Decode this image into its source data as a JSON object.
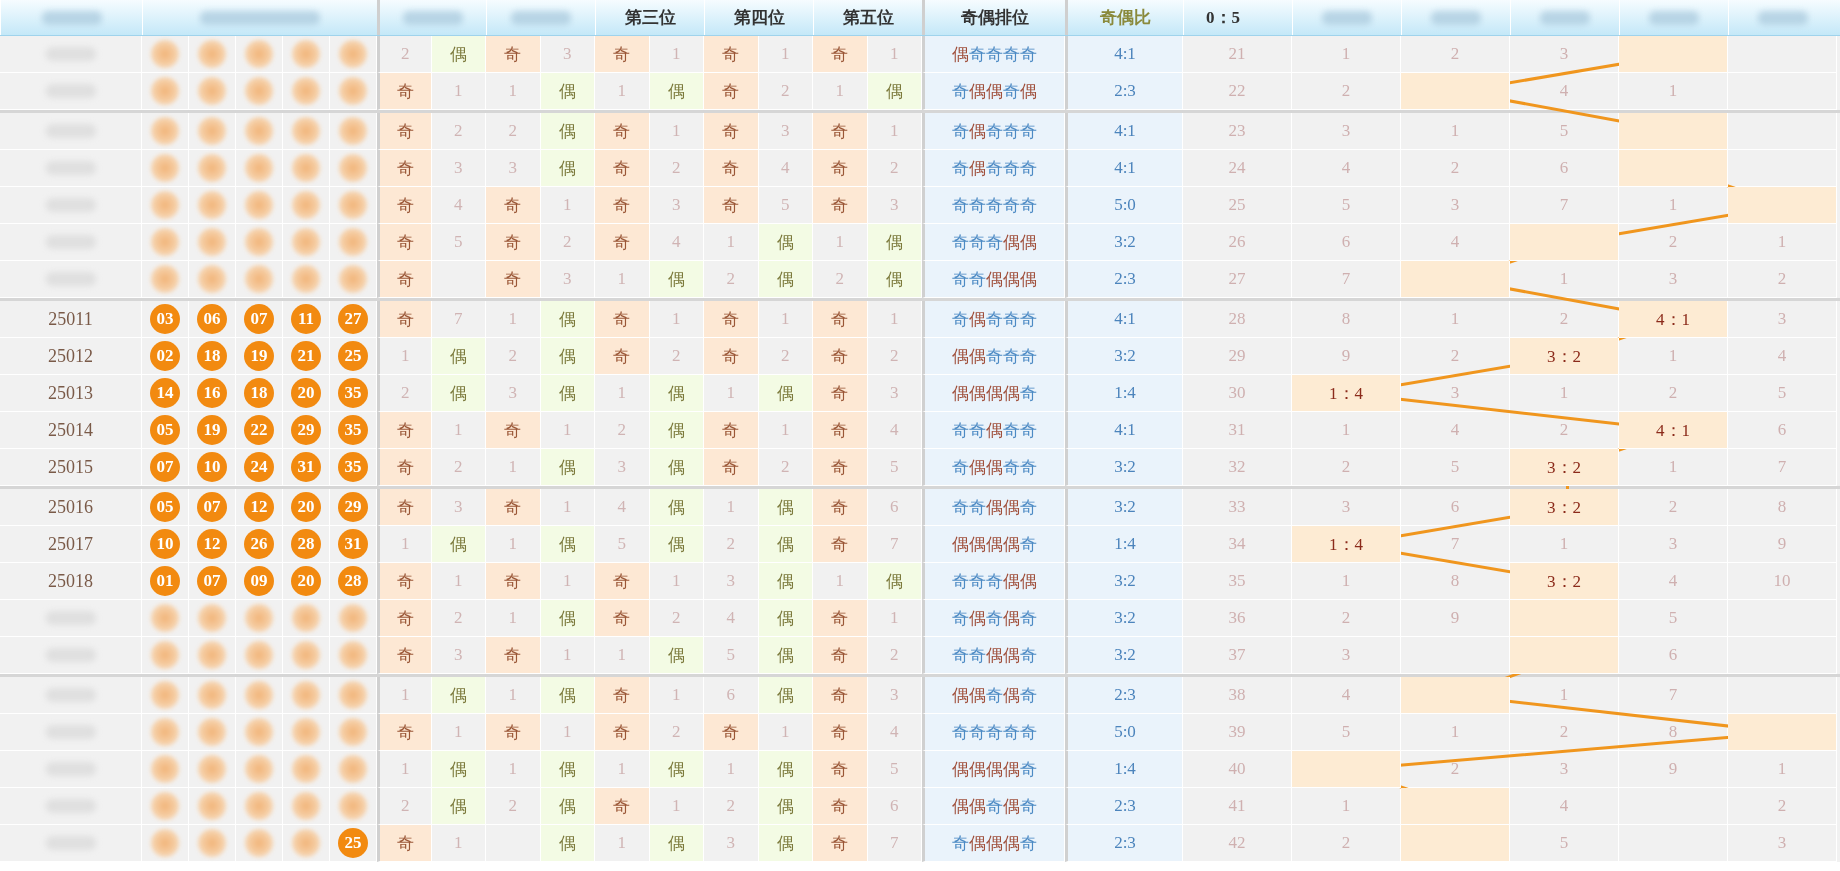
{
  "headers": {
    "issue": {
      "obscured": true
    },
    "balls": {
      "obscured": true
    },
    "positions": [
      {
        "obscured": true
      },
      {
        "obscured": true
      },
      {
        "obscured": false,
        "text": "第三位"
      },
      {
        "obscured": false,
        "text": "第四位"
      },
      {
        "obscured": false,
        "text": "第五位"
      }
    ],
    "pattern": "奇偶排位",
    "ratio": "奇偶比",
    "distribution": [
      {
        "obscured": false,
        "text": "0：5"
      },
      {
        "obscured": true
      },
      {
        "obscured": true
      },
      {
        "obscured": true
      },
      {
        "obscured": true
      },
      {
        "obscured": true
      }
    ]
  },
  "groups": [
    {
      "rows": [
        {
          "issue": {
            "obscured": true
          },
          "balls": [
            {
              "obscured": true
            },
            {
              "obscured": true
            },
            {
              "obscured": true
            },
            {
              "obscured": true
            },
            {
              "obscured": true
            }
          ],
          "positions": [
            {
              "kind": "even",
              "mark": "偶",
              "miss": "2"
            },
            {
              "kind": "odd",
              "mark": "奇",
              "miss": "3"
            },
            {
              "kind": "odd",
              "mark": "奇",
              "miss": "1"
            },
            {
              "kind": "odd",
              "mark": "奇",
              "miss": "1"
            },
            {
              "kind": "odd",
              "mark": "奇",
              "miss": "1"
            }
          ],
          "pattern": "偶奇奇奇奇",
          "ratio": "4:1",
          "distribution": [
            {
              "text": "21",
              "hit": false
            },
            {
              "text": "1",
              "hit": false
            },
            {
              "text": "2",
              "hit": false
            },
            {
              "text": "3",
              "hit": false
            },
            {
              "hit": true
            },
            {
              "hit": false
            }
          ]
        },
        {
          "issue": {
            "obscured": true
          },
          "balls": [
            {
              "obscured": true
            },
            {
              "obscured": true
            },
            {
              "obscured": true
            },
            {
              "obscured": true
            },
            {
              "obscured": true
            }
          ],
          "positions": [
            {
              "kind": "odd",
              "mark": "奇",
              "miss": "1"
            },
            {
              "kind": "even",
              "mark": "偶",
              "miss": "1"
            },
            {
              "kind": "even",
              "mark": "偶",
              "miss": "1"
            },
            {
              "kind": "odd",
              "mark": "奇",
              "miss": "2"
            },
            {
              "kind": "even",
              "mark": "偶",
              "miss": "1"
            }
          ],
          "pattern": "奇偶偶奇偶",
          "ratio": "2:3",
          "distribution": [
            {
              "text": "22",
              "hit": false
            },
            {
              "text": "2",
              "hit": false
            },
            {
              "hit": true
            },
            {
              "text": "4",
              "hit": false
            },
            {
              "text": "1",
              "hit": false
            },
            {
              "hit": false
            }
          ]
        }
      ]
    },
    {
      "rows": [
        {
          "issue": {
            "obscured": true
          },
          "balls": [
            {
              "obscured": true
            },
            {
              "obscured": true
            },
            {
              "obscured": true
            },
            {
              "obscured": true
            },
            {
              "obscured": true
            }
          ],
          "positions": [
            {
              "kind": "odd",
              "mark": "奇",
              "miss": "2"
            },
            {
              "kind": "even",
              "mark": "偶",
              "miss": "2"
            },
            {
              "kind": "odd",
              "mark": "奇",
              "miss": "1"
            },
            {
              "kind": "odd",
              "mark": "奇",
              "miss": "3"
            },
            {
              "kind": "odd",
              "mark": "奇",
              "miss": "1"
            }
          ],
          "pattern": "奇偶奇奇奇",
          "ratio": "4:1",
          "distribution": [
            {
              "text": "23",
              "hit": false
            },
            {
              "text": "3",
              "hit": false
            },
            {
              "text": "1",
              "hit": false
            },
            {
              "text": "5",
              "hit": false
            },
            {
              "hit": true
            },
            {
              "hit": false
            }
          ]
        },
        {
          "issue": {
            "obscured": true
          },
          "balls": [
            {
              "obscured": true
            },
            {
              "obscured": true
            },
            {
              "obscured": true
            },
            {
              "obscured": true
            },
            {
              "obscured": true
            }
          ],
          "positions": [
            {
              "kind": "odd",
              "mark": "奇",
              "miss": "3"
            },
            {
              "kind": "even",
              "mark": "偶",
              "miss": "3"
            },
            {
              "kind": "odd",
              "mark": "奇",
              "miss": "2"
            },
            {
              "kind": "odd",
              "mark": "奇",
              "miss": "4"
            },
            {
              "kind": "odd",
              "mark": "奇",
              "miss": "2"
            }
          ],
          "pattern": "奇偶奇奇奇",
          "ratio": "4:1",
          "distribution": [
            {
              "text": "24",
              "hit": false
            },
            {
              "text": "4",
              "hit": false
            },
            {
              "text": "2",
              "hit": false
            },
            {
              "text": "6",
              "hit": false
            },
            {
              "hit": true
            },
            {
              "hit": false
            }
          ]
        },
        {
          "issue": {
            "obscured": true
          },
          "balls": [
            {
              "obscured": true
            },
            {
              "obscured": true
            },
            {
              "obscured": true
            },
            {
              "obscured": true
            },
            {
              "obscured": true
            }
          ],
          "positions": [
            {
              "kind": "odd",
              "mark": "奇",
              "miss": "4"
            },
            {
              "kind": "odd",
              "mark": "奇",
              "miss": "1"
            },
            {
              "kind": "odd",
              "mark": "奇",
              "miss": "3"
            },
            {
              "kind": "odd",
              "mark": "奇",
              "miss": "5"
            },
            {
              "kind": "odd",
              "mark": "奇",
              "miss": "3"
            }
          ],
          "pattern": "奇奇奇奇奇",
          "ratio": "5:0",
          "distribution": [
            {
              "text": "25",
              "hit": false
            },
            {
              "text": "5",
              "hit": false
            },
            {
              "text": "3",
              "hit": false
            },
            {
              "text": "7",
              "hit": false
            },
            {
              "text": "1",
              "hit": false
            },
            {
              "hit": true
            }
          ]
        },
        {
          "issue": {
            "obscured": true
          },
          "balls": [
            {
              "obscured": true
            },
            {
              "obscured": true
            },
            {
              "obscured": true
            },
            {
              "obscured": true
            },
            {
              "obscured": true
            }
          ],
          "positions": [
            {
              "kind": "odd",
              "mark": "奇",
              "miss": "5"
            },
            {
              "kind": "odd",
              "mark": "奇",
              "miss": "2"
            },
            {
              "kind": "odd",
              "mark": "奇",
              "miss": "4"
            },
            {
              "kind": "even",
              "mark": "偶",
              "miss": "1"
            },
            {
              "kind": "even",
              "mark": "偶",
              "miss": "1"
            }
          ],
          "pattern": "奇奇奇偶偶",
          "ratio": "3:2",
          "distribution": [
            {
              "text": "26",
              "hit": false
            },
            {
              "text": "6",
              "hit": false
            },
            {
              "text": "4",
              "hit": false
            },
            {
              "hit": true
            },
            {
              "text": "2",
              "hit": false
            },
            {
              "text": "1",
              "hit": false
            }
          ]
        },
        {
          "issue": {
            "obscured": true
          },
          "balls": [
            {
              "obscured": true
            },
            {
              "obscured": true
            },
            {
              "obscured": true
            },
            {
              "obscured": true
            },
            {
              "obscured": true
            }
          ],
          "positions": [
            {
              "kind": "odd",
              "mark": "奇"
            },
            {
              "kind": "odd",
              "mark": "奇",
              "miss": "3"
            },
            {
              "kind": "even",
              "mark": "偶",
              "miss": "1"
            },
            {
              "kind": "even",
              "mark": "偶",
              "miss": "2"
            },
            {
              "kind": "even",
              "mark": "偶",
              "miss": "2"
            }
          ],
          "pattern": "奇奇偶偶偶",
          "ratio": "2:3",
          "distribution": [
            {
              "text": "27",
              "hit": false
            },
            {
              "text": "7",
              "hit": false
            },
            {
              "hit": true
            },
            {
              "text": "1",
              "hit": false
            },
            {
              "text": "3",
              "hit": false
            },
            {
              "text": "2",
              "hit": false
            }
          ]
        }
      ]
    },
    {
      "rows": [
        {
          "issue": {
            "obscured": false,
            "text": "25011"
          },
          "balls": [
            {
              "obscured": false,
              "text": "03"
            },
            {
              "obscured": false,
              "text": "06"
            },
            {
              "obscured": false,
              "text": "07"
            },
            {
              "obscured": false,
              "text": "11"
            },
            {
              "obscured": false,
              "text": "27"
            }
          ],
          "positions": [
            {
              "kind": "odd",
              "mark": "奇",
              "miss": "7"
            },
            {
              "kind": "even",
              "mark": "偶",
              "miss": "1"
            },
            {
              "kind": "odd",
              "mark": "奇",
              "miss": "1"
            },
            {
              "kind": "odd",
              "mark": "奇",
              "miss": "1"
            },
            {
              "kind": "odd",
              "mark": "奇",
              "miss": "1"
            }
          ],
          "pattern": "奇偶奇奇奇",
          "ratio": "4:1",
          "distribution": [
            {
              "text": "28",
              "hit": false
            },
            {
              "text": "8",
              "hit": false
            },
            {
              "text": "1",
              "hit": false
            },
            {
              "text": "2",
              "hit": false
            },
            {
              "text": "4：1",
              "hit": true
            },
            {
              "text": "3",
              "hit": false
            }
          ]
        },
        {
          "issue": {
            "obscured": false,
            "text": "25012"
          },
          "balls": [
            {
              "obscured": false,
              "text": "02"
            },
            {
              "obscured": false,
              "text": "18"
            },
            {
              "obscured": false,
              "text": "19"
            },
            {
              "obscured": false,
              "text": "21"
            },
            {
              "obscured": false,
              "text": "25"
            }
          ],
          "positions": [
            {
              "kind": "even",
              "mark": "偶",
              "miss": "1"
            },
            {
              "kind": "even",
              "mark": "偶",
              "miss": "2"
            },
            {
              "kind": "odd",
              "mark": "奇",
              "miss": "2"
            },
            {
              "kind": "odd",
              "mark": "奇",
              "miss": "2"
            },
            {
              "kind": "odd",
              "mark": "奇",
              "miss": "2"
            }
          ],
          "pattern": "偶偶奇奇奇",
          "ratio": "3:2",
          "distribution": [
            {
              "text": "29",
              "hit": false
            },
            {
              "text": "9",
              "hit": false
            },
            {
              "text": "2",
              "hit": false
            },
            {
              "text": "3：2",
              "hit": true
            },
            {
              "text": "1",
              "hit": false
            },
            {
              "text": "4",
              "hit": false
            }
          ]
        },
        {
          "issue": {
            "obscured": false,
            "text": "25013"
          },
          "balls": [
            {
              "obscured": false,
              "text": "14"
            },
            {
              "obscured": false,
              "text": "16"
            },
            {
              "obscured": false,
              "text": "18"
            },
            {
              "obscured": false,
              "text": "20"
            },
            {
              "obscured": false,
              "text": "35"
            }
          ],
          "positions": [
            {
              "kind": "even",
              "mark": "偶",
              "miss": "2"
            },
            {
              "kind": "even",
              "mark": "偶",
              "miss": "3"
            },
            {
              "kind": "even",
              "mark": "偶",
              "miss": "1"
            },
            {
              "kind": "even",
              "mark": "偶",
              "miss": "1"
            },
            {
              "kind": "odd",
              "mark": "奇",
              "miss": "3"
            }
          ],
          "pattern": "偶偶偶偶奇",
          "ratio": "1:4",
          "distribution": [
            {
              "text": "30",
              "hit": false
            },
            {
              "text": "1：4",
              "hit": true
            },
            {
              "text": "3",
              "hit": false
            },
            {
              "text": "1",
              "hit": false
            },
            {
              "text": "2",
              "hit": false
            },
            {
              "text": "5",
              "hit": false
            }
          ]
        },
        {
          "issue": {
            "obscured": false,
            "text": "25014"
          },
          "balls": [
            {
              "obscured": false,
              "text": "05"
            },
            {
              "obscured": false,
              "text": "19"
            },
            {
              "obscured": false,
              "text": "22"
            },
            {
              "obscured": false,
              "text": "29"
            },
            {
              "obscured": false,
              "text": "35"
            }
          ],
          "positions": [
            {
              "kind": "odd",
              "mark": "奇",
              "miss": "1"
            },
            {
              "kind": "odd",
              "mark": "奇",
              "miss": "1"
            },
            {
              "kind": "even",
              "mark": "偶",
              "miss": "2"
            },
            {
              "kind": "odd",
              "mark": "奇",
              "miss": "1"
            },
            {
              "kind": "odd",
              "mark": "奇",
              "miss": "4"
            }
          ],
          "pattern": "奇奇偶奇奇",
          "ratio": "4:1",
          "distribution": [
            {
              "text": "31",
              "hit": false
            },
            {
              "text": "1",
              "hit": false
            },
            {
              "text": "4",
              "hit": false
            },
            {
              "text": "2",
              "hit": false
            },
            {
              "text": "4：1",
              "hit": true
            },
            {
              "text": "6",
              "hit": false
            }
          ]
        },
        {
          "issue": {
            "obscured": false,
            "text": "25015"
          },
          "balls": [
            {
              "obscured": false,
              "text": "07"
            },
            {
              "obscured": false,
              "text": "10"
            },
            {
              "obscured": false,
              "text": "24"
            },
            {
              "obscured": false,
              "text": "31"
            },
            {
              "obscured": false,
              "text": "35"
            }
          ],
          "positions": [
            {
              "kind": "odd",
              "mark": "奇",
              "miss": "2"
            },
            {
              "kind": "even",
              "mark": "偶",
              "miss": "1"
            },
            {
              "kind": "even",
              "mark": "偶",
              "miss": "3"
            },
            {
              "kind": "odd",
              "mark": "奇",
              "miss": "2"
            },
            {
              "kind": "odd",
              "mark": "奇",
              "miss": "5"
            }
          ],
          "pattern": "奇偶偶奇奇",
          "ratio": "3:2",
          "distribution": [
            {
              "text": "32",
              "hit": false
            },
            {
              "text": "2",
              "hit": false
            },
            {
              "text": "5",
              "hit": false
            },
            {
              "text": "3：2",
              "hit": true
            },
            {
              "text": "1",
              "hit": false
            },
            {
              "text": "7",
              "hit": false
            }
          ]
        }
      ]
    },
    {
      "rows": [
        {
          "issue": {
            "obscured": false,
            "text": "25016"
          },
          "balls": [
            {
              "obscured": false,
              "text": "05"
            },
            {
              "obscured": false,
              "text": "07"
            },
            {
              "obscured": false,
              "text": "12"
            },
            {
              "obscured": false,
              "text": "20"
            },
            {
              "obscured": false,
              "text": "29"
            }
          ],
          "positions": [
            {
              "kind": "odd",
              "mark": "奇",
              "miss": "3"
            },
            {
              "kind": "odd",
              "mark": "奇",
              "miss": "1"
            },
            {
              "kind": "even",
              "mark": "偶",
              "miss": "4"
            },
            {
              "kind": "even",
              "mark": "偶",
              "miss": "1"
            },
            {
              "kind": "odd",
              "mark": "奇",
              "miss": "6"
            }
          ],
          "pattern": "奇奇偶偶奇",
          "ratio": "3:2",
          "distribution": [
            {
              "text": "33",
              "hit": false
            },
            {
              "text": "3",
              "hit": false
            },
            {
              "text": "6",
              "hit": false
            },
            {
              "text": "3：2",
              "hit": true
            },
            {
              "text": "2",
              "hit": false
            },
            {
              "text": "8",
              "hit": false
            }
          ]
        },
        {
          "issue": {
            "obscured": false,
            "text": "25017"
          },
          "balls": [
            {
              "obscured": false,
              "text": "10"
            },
            {
              "obscured": false,
              "text": "12"
            },
            {
              "obscured": false,
              "text": "26"
            },
            {
              "obscured": false,
              "text": "28"
            },
            {
              "obscured": false,
              "text": "31"
            }
          ],
          "positions": [
            {
              "kind": "even",
              "mark": "偶",
              "miss": "1"
            },
            {
              "kind": "even",
              "mark": "偶",
              "miss": "1"
            },
            {
              "kind": "even",
              "mark": "偶",
              "miss": "5"
            },
            {
              "kind": "even",
              "mark": "偶",
              "miss": "2"
            },
            {
              "kind": "odd",
              "mark": "奇",
              "miss": "7"
            }
          ],
          "pattern": "偶偶偶偶奇",
          "ratio": "1:4",
          "distribution": [
            {
              "text": "34",
              "hit": false
            },
            {
              "text": "1：4",
              "hit": true
            },
            {
              "text": "7",
              "hit": false
            },
            {
              "text": "1",
              "hit": false
            },
            {
              "text": "3",
              "hit": false
            },
            {
              "text": "9",
              "hit": false
            }
          ]
        },
        {
          "issue": {
            "obscured": false,
            "text": "25018"
          },
          "balls": [
            {
              "obscured": false,
              "text": "01"
            },
            {
              "obscured": false,
              "text": "07"
            },
            {
              "obscured": false,
              "text": "09"
            },
            {
              "obscured": false,
              "text": "20"
            },
            {
              "obscured": false,
              "text": "28"
            }
          ],
          "positions": [
            {
              "kind": "odd",
              "mark": "奇",
              "miss": "1"
            },
            {
              "kind": "odd",
              "mark": "奇",
              "miss": "1"
            },
            {
              "kind": "odd",
              "mark": "奇",
              "miss": "1"
            },
            {
              "kind": "even",
              "mark": "偶",
              "miss": "3"
            },
            {
              "kind": "even",
              "mark": "偶",
              "miss": "1"
            }
          ],
          "pattern": "奇奇奇偶偶",
          "ratio": "3:2",
          "distribution": [
            {
              "text": "35",
              "hit": false
            },
            {
              "text": "1",
              "hit": false
            },
            {
              "text": "8",
              "hit": false
            },
            {
              "text": "3：2",
              "hit": true
            },
            {
              "text": "4",
              "hit": false
            },
            {
              "text": "10",
              "hit": false
            }
          ]
        },
        {
          "issue": {
            "obscured": true
          },
          "balls": [
            {
              "obscured": true
            },
            {
              "obscured": true
            },
            {
              "obscured": true
            },
            {
              "obscured": true
            },
            {
              "obscured": true
            }
          ],
          "positions": [
            {
              "kind": "odd",
              "mark": "奇",
              "miss": "2"
            },
            {
              "kind": "even",
              "mark": "偶",
              "miss": "1"
            },
            {
              "kind": "odd",
              "mark": "奇",
              "miss": "2"
            },
            {
              "kind": "even",
              "mark": "偶",
              "miss": "4"
            },
            {
              "kind": "odd",
              "mark": "奇",
              "miss": "1"
            }
          ],
          "pattern": "奇偶奇偶奇",
          "ratio": "3:2",
          "distribution": [
            {
              "text": "36",
              "hit": false
            },
            {
              "text": "2",
              "hit": false
            },
            {
              "text": "9",
              "hit": false
            },
            {
              "hit": true
            },
            {
              "text": "5",
              "hit": false
            },
            {
              "hit": false
            }
          ]
        },
        {
          "issue": {
            "obscured": true
          },
          "balls": [
            {
              "obscured": true
            },
            {
              "obscured": true
            },
            {
              "obscured": true
            },
            {
              "obscured": true
            },
            {
              "obscured": true
            }
          ],
          "positions": [
            {
              "kind": "odd",
              "mark": "奇",
              "miss": "3"
            },
            {
              "kind": "odd",
              "mark": "奇",
              "miss": "1"
            },
            {
              "kind": "even",
              "mark": "偶",
              "miss": "1"
            },
            {
              "kind": "even",
              "mark": "偶",
              "miss": "5"
            },
            {
              "kind": "odd",
              "mark": "奇",
              "miss": "2"
            }
          ],
          "pattern": "奇奇偶偶奇",
          "ratio": "3:2",
          "distribution": [
            {
              "text": "37",
              "hit": false
            },
            {
              "text": "3",
              "hit": false
            },
            {
              "hit": false
            },
            {
              "hit": true
            },
            {
              "text": "6",
              "hit": false
            },
            {
              "hit": false
            }
          ]
        }
      ]
    },
    {
      "rows": [
        {
          "issue": {
            "obscured": true
          },
          "balls": [
            {
              "obscured": true
            },
            {
              "obscured": true
            },
            {
              "obscured": true
            },
            {
              "obscured": true
            },
            {
              "obscured": true
            }
          ],
          "positions": [
            {
              "kind": "even",
              "mark": "偶",
              "miss": "1"
            },
            {
              "kind": "even",
              "mark": "偶",
              "miss": "1"
            },
            {
              "kind": "odd",
              "mark": "奇",
              "miss": "1"
            },
            {
              "kind": "even",
              "mark": "偶",
              "miss": "6"
            },
            {
              "kind": "odd",
              "mark": "奇",
              "miss": "3"
            }
          ],
          "pattern": "偶偶奇偶奇",
          "ratio": "2:3",
          "distribution": [
            {
              "text": "38",
              "hit": false
            },
            {
              "text": "4",
              "hit": false
            },
            {
              "hit": true
            },
            {
              "text": "1",
              "hit": false
            },
            {
              "text": "7",
              "hit": false
            },
            {
              "hit": false
            }
          ]
        },
        {
          "issue": {
            "obscured": true
          },
          "balls": [
            {
              "obscured": true
            },
            {
              "obscured": true
            },
            {
              "obscured": true
            },
            {
              "obscured": true
            },
            {
              "obscured": true
            }
          ],
          "positions": [
            {
              "kind": "odd",
              "mark": "奇",
              "miss": "1"
            },
            {
              "kind": "odd",
              "mark": "奇",
              "miss": "1"
            },
            {
              "kind": "odd",
              "mark": "奇",
              "miss": "2"
            },
            {
              "kind": "odd",
              "mark": "奇",
              "miss": "1"
            },
            {
              "kind": "odd",
              "mark": "奇",
              "miss": "4"
            }
          ],
          "pattern": "奇奇奇奇奇",
          "ratio": "5:0",
          "distribution": [
            {
              "text": "39",
              "hit": false
            },
            {
              "text": "5",
              "hit": false
            },
            {
              "text": "1",
              "hit": false
            },
            {
              "text": "2",
              "hit": false
            },
            {
              "text": "8",
              "hit": false
            },
            {
              "hit": true
            }
          ]
        },
        {
          "issue": {
            "obscured": true
          },
          "balls": [
            {
              "obscured": true
            },
            {
              "obscured": true
            },
            {
              "obscured": true
            },
            {
              "obscured": true
            },
            {
              "obscured": true
            }
          ],
          "positions": [
            {
              "kind": "even",
              "mark": "偶",
              "miss": "1"
            },
            {
              "kind": "even",
              "mark": "偶",
              "miss": "1"
            },
            {
              "kind": "even",
              "mark": "偶",
              "miss": "1"
            },
            {
              "kind": "even",
              "mark": "偶",
              "miss": "1"
            },
            {
              "kind": "odd",
              "mark": "奇",
              "miss": "5"
            }
          ],
          "pattern": "偶偶偶偶奇",
          "ratio": "1:4",
          "distribution": [
            {
              "text": "40",
              "hit": false
            },
            {
              "hit": true
            },
            {
              "text": "2",
              "hit": false
            },
            {
              "text": "3",
              "hit": false
            },
            {
              "text": "9",
              "hit": false
            },
            {
              "text": "1",
              "hit": false
            }
          ]
        },
        {
          "issue": {
            "obscured": true
          },
          "balls": [
            {
              "obscured": true
            },
            {
              "obscured": true
            },
            {
              "obscured": true
            },
            {
              "obscured": true
            },
            {
              "obscured": true
            }
          ],
          "positions": [
            {
              "kind": "even",
              "mark": "偶",
              "miss": "2"
            },
            {
              "kind": "even",
              "mark": "偶",
              "miss": "2"
            },
            {
              "kind": "odd",
              "mark": "奇",
              "miss": "1"
            },
            {
              "kind": "even",
              "mark": "偶",
              "miss": "2"
            },
            {
              "kind": "odd",
              "mark": "奇",
              "miss": "6"
            }
          ],
          "pattern": "偶偶奇偶奇",
          "ratio": "2:3",
          "distribution": [
            {
              "text": "41",
              "hit": false
            },
            {
              "text": "1",
              "hit": false
            },
            {
              "hit": true
            },
            {
              "text": "4",
              "hit": false
            },
            {
              "hit": false
            },
            {
              "text": "2",
              "hit": false
            }
          ]
        },
        {
          "issue": {
            "obscured": true
          },
          "balls": [
            {
              "obscured": true
            },
            {
              "obscured": true
            },
            {
              "obscured": true
            },
            {
              "obscured": true
            },
            {
              "obscured": false,
              "text": "25"
            }
          ],
          "positions": [
            {
              "kind": "odd",
              "mark": "奇",
              "miss": "1"
            },
            {
              "kind": "even",
              "mark": "偶"
            },
            {
              "kind": "even",
              "mark": "偶",
              "miss": "1"
            },
            {
              "kind": "even",
              "mark": "偶",
              "miss": "3"
            },
            {
              "kind": "odd",
              "mark": "奇",
              "miss": "7"
            }
          ],
          "pattern": "奇偶偶偶奇",
          "ratio": "2:3",
          "distribution": [
            {
              "text": "42",
              "hit": false
            },
            {
              "text": "2",
              "hit": false
            },
            {
              "hit": true
            },
            {
              "text": "5",
              "hit": false
            },
            {
              "hit": false
            },
            {
              "text": "3",
              "hit": false
            }
          ]
        }
      ]
    }
  ]
}
